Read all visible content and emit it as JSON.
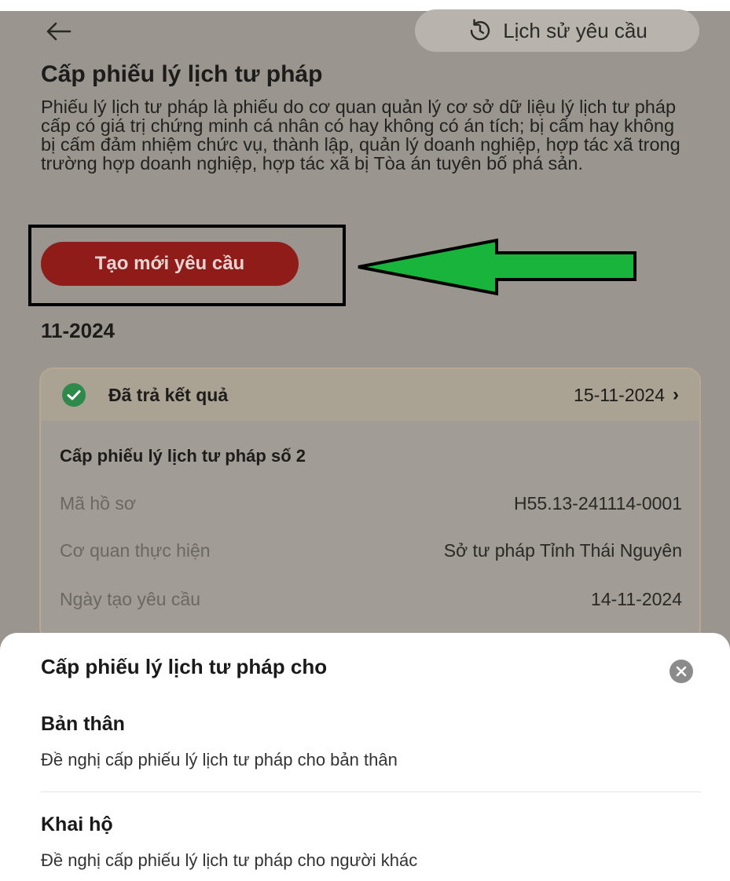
{
  "header": {
    "history_label": "Lịch sử yêu cầu"
  },
  "page": {
    "title": "Cấp phiếu lý lịch tư pháp",
    "description": "Phiếu lý lịch tư pháp là phiếu do cơ quan quản lý cơ sở dữ liệu lý lịch tư pháp cấp có giá trị chứng minh cá nhân có hay không có án tích; bị cấm hay không bị cấm đảm nhiệm chức vụ, thành lập, quản lý doanh nghiệp, hợp tác xã trong trường hợp doanh nghiệp, hợp tác xã bị Tòa án tuyên bố phá sản.",
    "create_button": "Tạo mới yêu cầu",
    "month": "11-2024"
  },
  "request_card": {
    "status": "Đã trả kết quả",
    "status_date": "15-11-2024",
    "title": "Cấp phiếu lý lịch tư pháp số 2",
    "rows": [
      {
        "label": "Mã hồ sơ",
        "value": "H55.13-241114-0001"
      },
      {
        "label": "Cơ quan thực hiện",
        "value": "Sở tư pháp Tỉnh Thái Nguyên"
      },
      {
        "label": "Ngày tạo yêu cầu",
        "value": "14-11-2024"
      }
    ]
  },
  "bottom_sheet": {
    "title": "Cấp phiếu lý lịch tư pháp cho",
    "options": [
      {
        "title": "Bản thân",
        "description": "Đề nghị cấp phiếu lý lịch tư pháp cho bản thân"
      },
      {
        "title": "Khai hộ",
        "description": "Đề nghị cấp phiếu lý lịch tư pháp cho người khác"
      }
    ]
  },
  "colors": {
    "accent_red": "#8f1c18",
    "success_green": "#2e8a4a",
    "annotation_arrow": "#18b43c"
  },
  "icons": [
    "back-arrow-icon",
    "history-clock-icon",
    "check-circle-icon",
    "chevron-right-icon",
    "close-icon"
  ]
}
